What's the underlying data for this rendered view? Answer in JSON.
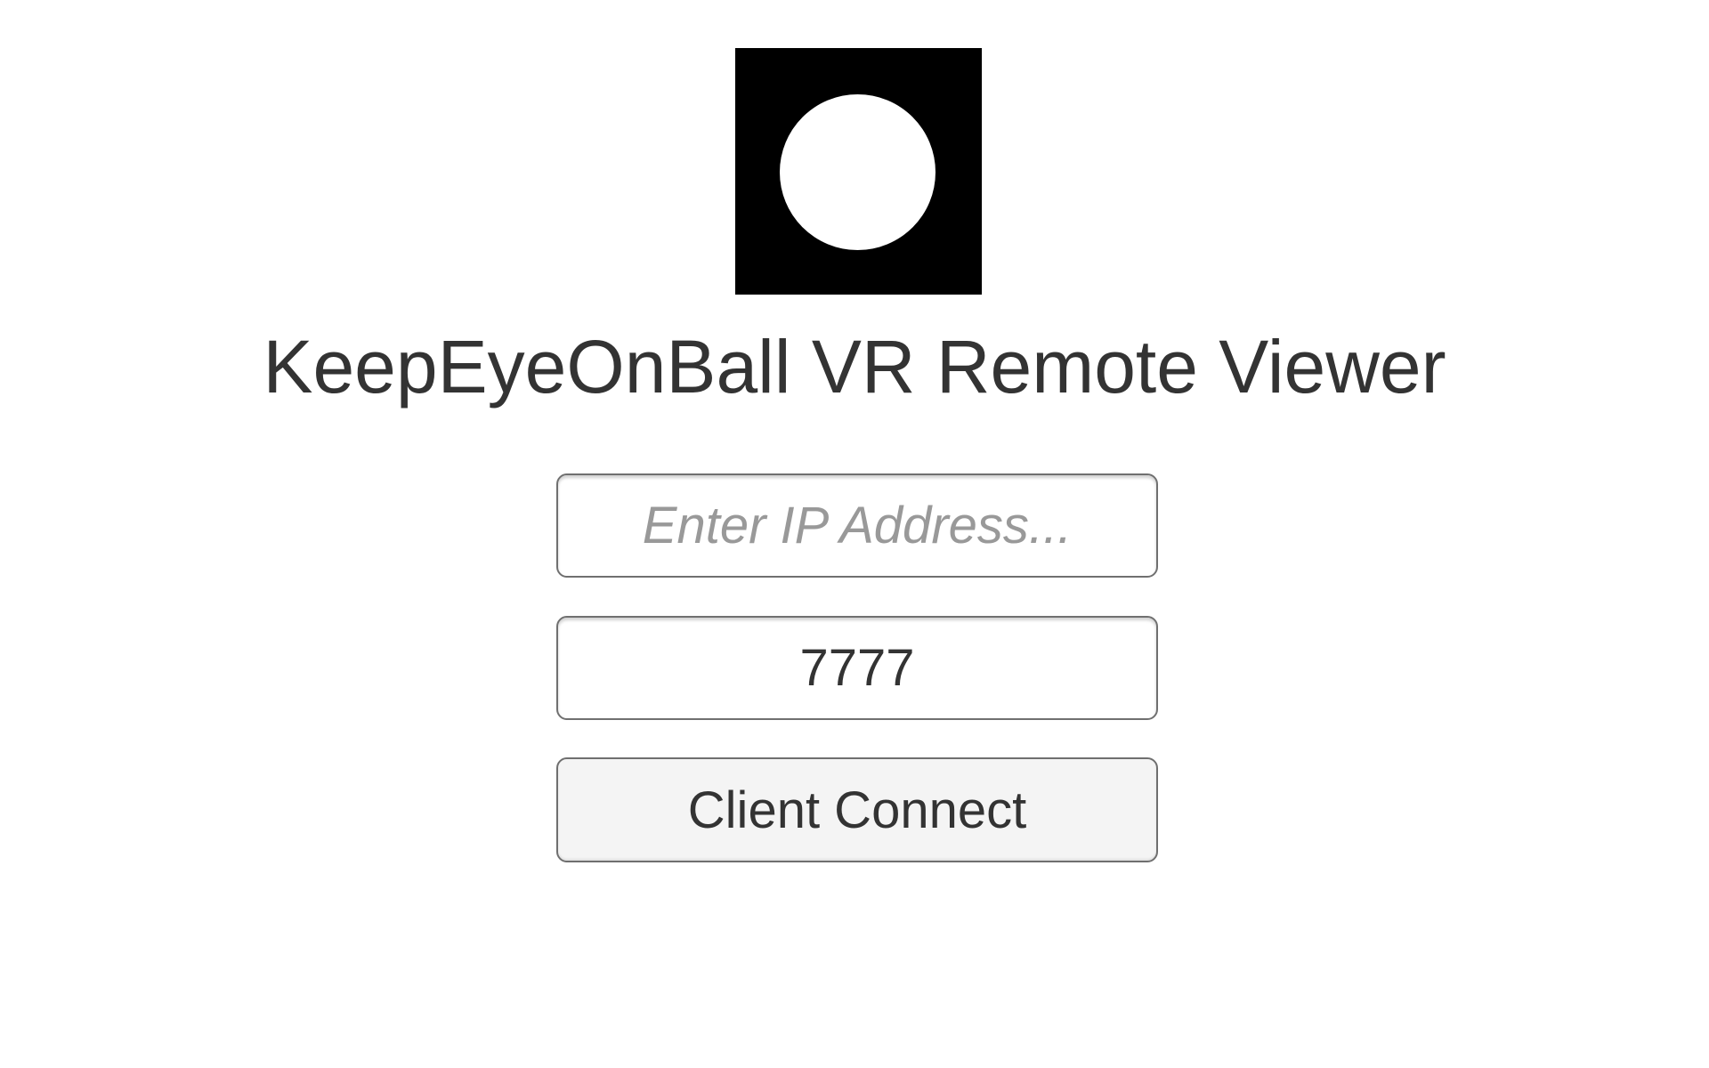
{
  "app": {
    "title": "KeepEyeOnBall VR Remote Viewer",
    "logo_icon": "ball-icon"
  },
  "form": {
    "ip_address": {
      "value": "",
      "placeholder": "Enter IP Address..."
    },
    "port": {
      "value": "7777"
    },
    "connect_button_label": "Client Connect"
  },
  "colors": {
    "background": "#ffffff",
    "text": "#333333",
    "placeholder": "#999999",
    "logo_background": "#000000",
    "logo_ball": "#ffffff",
    "button_background": "#f4f4f4",
    "border": "#707070"
  }
}
